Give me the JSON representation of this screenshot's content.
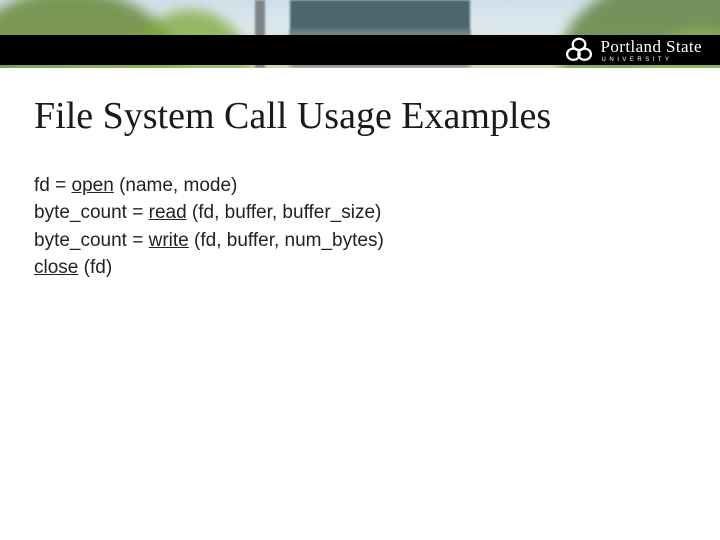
{
  "brand": {
    "name": "Portland State",
    "sub": "UNIVERSITY"
  },
  "title": "File System Call Usage Examples",
  "lines": {
    "l1": {
      "a": "fd",
      "b": " = ",
      "c": "open",
      "d": " (name, mode)"
    },
    "l2": {
      "a": "byte_count = ",
      "b": "read",
      "c": " (",
      "d": "fd",
      "e": ", buffer, buffer_size)"
    },
    "l3": {
      "a": "byte_count = ",
      "b": "write",
      "c": " (",
      "d": "fd",
      "e": ", buffer, num_bytes)"
    },
    "l4": {
      "a": "close",
      "b": " (",
      "c": "fd",
      "d": ")"
    }
  }
}
